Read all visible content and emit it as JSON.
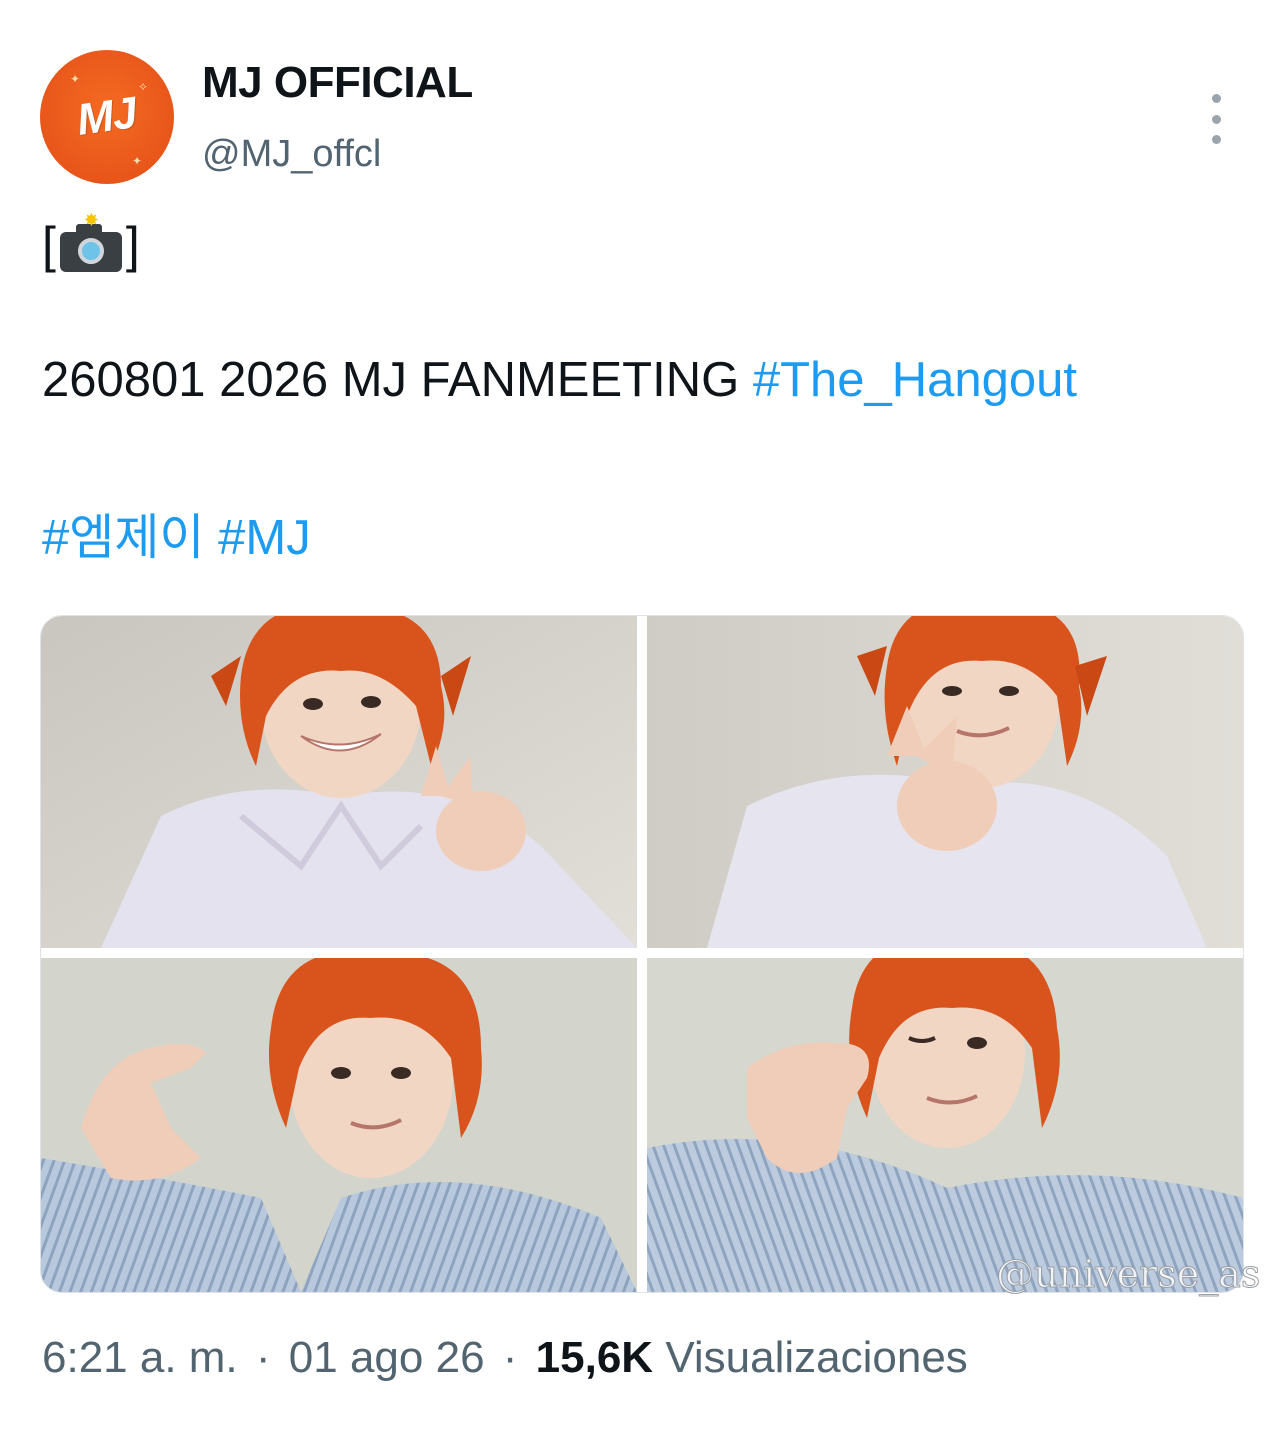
{
  "author": {
    "avatar_text": "MJ",
    "display_name": "MJ OFFICIAL",
    "handle": "@MJ_offcl"
  },
  "tweet": {
    "camera_open": "[",
    "camera_close": "]",
    "line1_text": "260801 2026 MJ FANMEETING ",
    "line1_hashtag": "#The_Hangout",
    "hashtag_1": "#엠제이",
    "hashtag_2": "#MJ",
    "icon": "camera-with-flash-icon"
  },
  "media": {
    "count": 4,
    "watermark": "@universe_as"
  },
  "meta": {
    "time": "6:21 a. m.",
    "separator": "·",
    "date": "01 ago 26",
    "views_count": "15,6K",
    "views_label": "Visualizaciones"
  },
  "colors": {
    "link": "#1d9bf0",
    "text": "#0f1419",
    "muted": "#536471",
    "avatar_bg": "#e8561a",
    "hair": "#d9541c"
  }
}
